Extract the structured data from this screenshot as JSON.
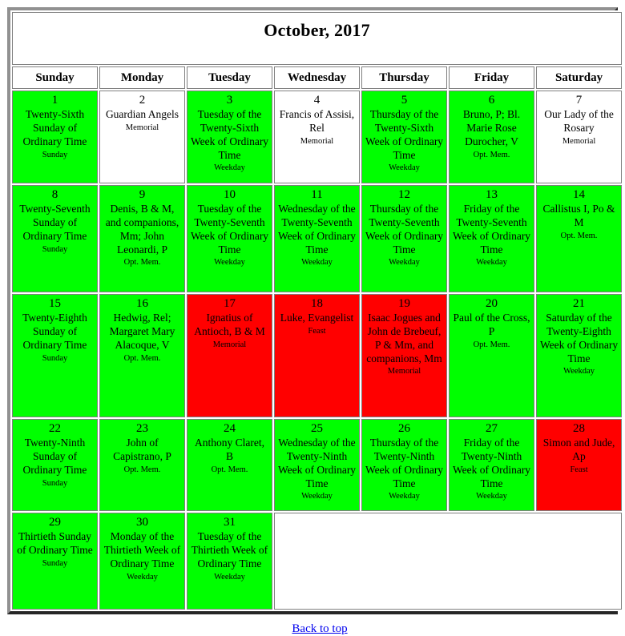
{
  "title": "October, 2017",
  "weekday_headers": [
    "Sunday",
    "Monday",
    "Tuesday",
    "Wednesday",
    "Thursday",
    "Friday",
    "Saturday"
  ],
  "colors": {
    "green": "#00FF00",
    "red": "#FF0000",
    "white": "#FFFFFF",
    "link": "#0000EE",
    "border": "#808080",
    "frame_light": "#919191",
    "frame_dark": "#262626"
  },
  "footer": {
    "back_to_top": "Back to top"
  },
  "weeks": [
    [
      {
        "num": "1",
        "title": "Twenty-Sixth Sunday of Ordinary Time",
        "rank": "Sunday",
        "color": "green"
      },
      {
        "num": "2",
        "title": "Guardian Angels",
        "rank": "Memorial",
        "color": "white"
      },
      {
        "num": "3",
        "title": "Tuesday of the Twenty-Sixth Week of Ordinary Time",
        "rank": "Weekday",
        "color": "green"
      },
      {
        "num": "4",
        "title": "Francis of Assisi, Rel",
        "rank": "Memorial",
        "color": "white"
      },
      {
        "num": "5",
        "title": "Thursday of the Twenty-Sixth Week of Ordinary Time",
        "rank": "Weekday",
        "color": "green"
      },
      {
        "num": "6",
        "title": "Bruno, P; Bl. Marie Rose Durocher, V",
        "rank": "Opt. Mem.",
        "color": "green"
      },
      {
        "num": "7",
        "title": "Our Lady of the Rosary",
        "rank": "Memorial",
        "color": "white"
      }
    ],
    [
      {
        "num": "8",
        "title": "Twenty-Seventh Sunday of Ordinary Time",
        "rank": "Sunday",
        "color": "green"
      },
      {
        "num": "9",
        "title": "Denis, B & M, and companions, Mm; John Leonardi, P",
        "rank": "Opt. Mem.",
        "color": "green"
      },
      {
        "num": "10",
        "title": "Tuesday of the Twenty-Seventh Week of Ordinary Time",
        "rank": "Weekday",
        "color": "green"
      },
      {
        "num": "11",
        "title": "Wednesday of the Twenty-Seventh Week of Ordinary Time",
        "rank": "Weekday",
        "color": "green"
      },
      {
        "num": "12",
        "title": "Thursday of the Twenty-Seventh Week of Ordinary Time",
        "rank": "Weekday",
        "color": "green"
      },
      {
        "num": "13",
        "title": "Friday of the Twenty-Seventh Week of Ordinary Time",
        "rank": "Weekday",
        "color": "green"
      },
      {
        "num": "14",
        "title": "Callistus I, Po & M",
        "rank": "Opt. Mem.",
        "color": "green"
      }
    ],
    [
      {
        "num": "15",
        "title": "Twenty-Eighth Sunday of Ordinary Time",
        "rank": "Sunday",
        "color": "green"
      },
      {
        "num": "16",
        "title": "Hedwig, Rel; Margaret Mary Alacoque, V",
        "rank": "Opt. Mem.",
        "color": "green"
      },
      {
        "num": "17",
        "title": "Ignatius of Antioch, B & M",
        "rank": "Memorial",
        "color": "red"
      },
      {
        "num": "18",
        "title": "Luke, Evangelist",
        "rank": "Feast",
        "color": "red"
      },
      {
        "num": "19",
        "title": "Isaac Jogues and John de Brebeuf, P & Mm, and companions, Mm",
        "rank": "Memorial",
        "color": "red"
      },
      {
        "num": "20",
        "title": "Paul of the Cross, P",
        "rank": "Opt. Mem.",
        "color": "green"
      },
      {
        "num": "21",
        "title": "Saturday of the Twenty-Eighth Week of Ordinary Time",
        "rank": "Weekday",
        "color": "green"
      }
    ],
    [
      {
        "num": "22",
        "title": "Twenty-Ninth Sunday of Ordinary Time",
        "rank": "Sunday",
        "color": "green"
      },
      {
        "num": "23",
        "title": "John of Capistrano, P",
        "rank": "Opt. Mem.",
        "color": "green"
      },
      {
        "num": "24",
        "title": "Anthony Claret, B",
        "rank": "Opt. Mem.",
        "color": "green"
      },
      {
        "num": "25",
        "title": "Wednesday of the Twenty-Ninth Week of Ordinary Time",
        "rank": "Weekday",
        "color": "green"
      },
      {
        "num": "26",
        "title": "Thursday of the Twenty-Ninth Week of Ordinary Time",
        "rank": "Weekday",
        "color": "green"
      },
      {
        "num": "27",
        "title": "Friday of the Twenty-Ninth Week of Ordinary Time",
        "rank": "Weekday",
        "color": "green"
      },
      {
        "num": "28",
        "title": "Simon and Jude, Ap",
        "rank": "Feast",
        "color": "red"
      }
    ],
    [
      {
        "num": "29",
        "title": "Thirtieth Sunday of Ordinary Time",
        "rank": "Sunday",
        "color": "green"
      },
      {
        "num": "30",
        "title": "Monday of the Thirtieth Week of Ordinary Time",
        "rank": "Weekday",
        "color": "green"
      },
      {
        "num": "31",
        "title": "Tuesday of the Thirtieth Week of Ordinary Time",
        "rank": "Weekday",
        "color": "green"
      },
      {
        "num": "",
        "title": "",
        "rank": "",
        "color": "blank",
        "span": 4
      }
    ]
  ]
}
